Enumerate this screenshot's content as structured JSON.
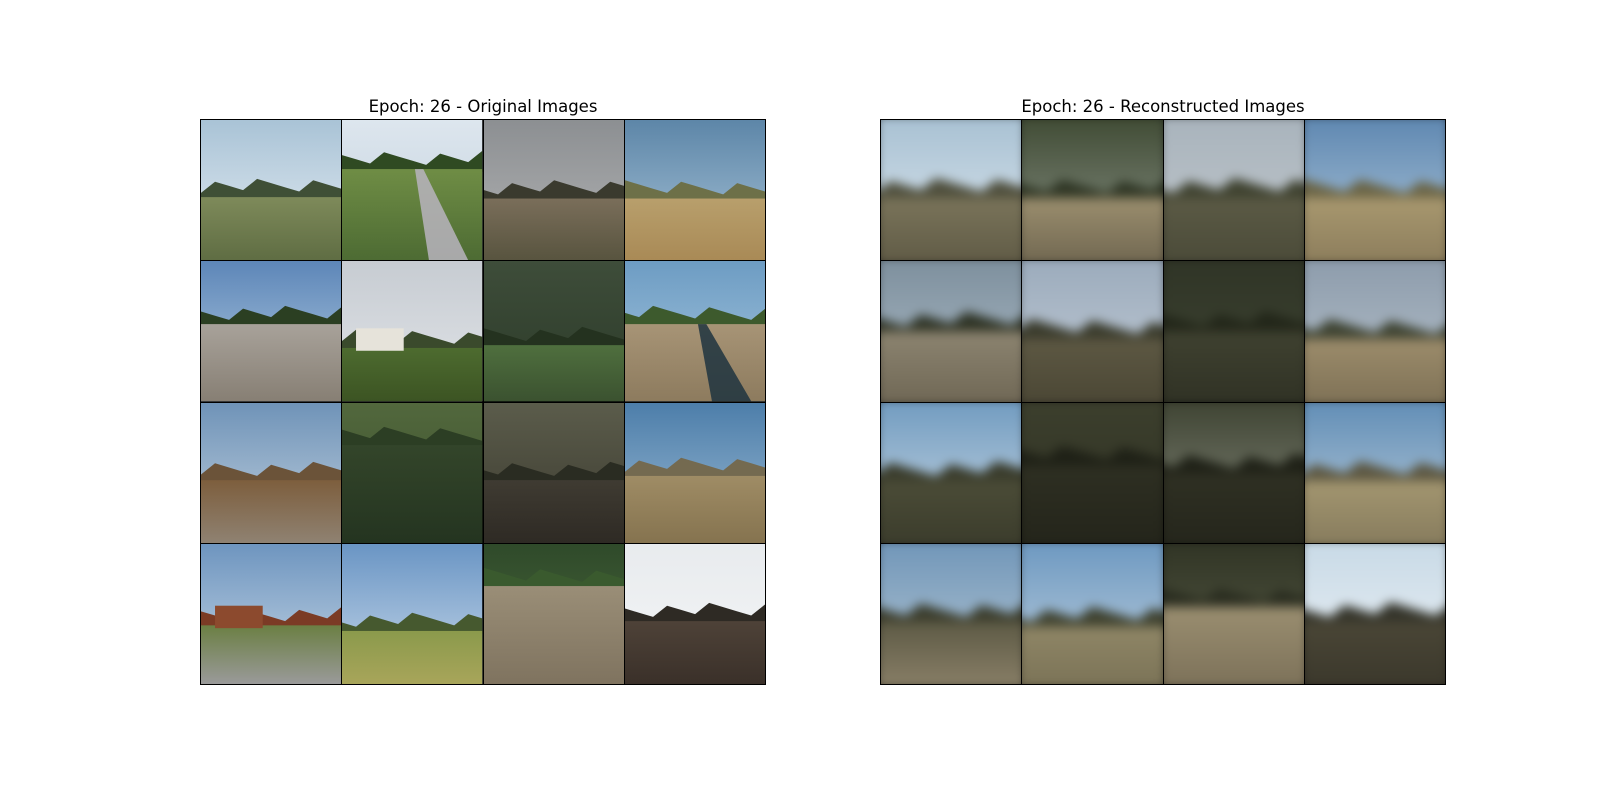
{
  "panels": [
    {
      "title": "Epoch: 26 - Original Images",
      "kind": "original",
      "tiles": [
        {
          "name": "original-tile-1",
          "sky": [
            "#a9c3d6",
            "#e6edf3"
          ],
          "horizon": 0.55,
          "ground": [
            "#7e8a5a",
            "#5f6d43"
          ],
          "trees": "#3f4f36"
        },
        {
          "name": "original-tile-2",
          "sky": [
            "#dde6ee",
            "#c0cfdc"
          ],
          "horizon": 0.35,
          "ground": [
            "#6f8d45",
            "#4d6b33"
          ],
          "trees": "#2f4a22",
          "road": "#b9b4be"
        },
        {
          "name": "original-tile-3",
          "sky": [
            "#8c8f92",
            "#b2b3b4"
          ],
          "horizon": 0.56,
          "ground": [
            "#7a6e5a",
            "#58543f"
          ],
          "trees": "#3a3a2e"
        },
        {
          "name": "original-tile-4",
          "sky": [
            "#5d86a8",
            "#a9c4d8"
          ],
          "horizon": 0.56,
          "ground": [
            "#b89f6c",
            "#a98a56"
          ],
          "trees": "#6d7048"
        },
        {
          "name": "original-tile-5",
          "sky": [
            "#5d86b8",
            "#b6cfe3"
          ],
          "horizon": 0.45,
          "ground": [
            "#a8a29a",
            "#877f74"
          ],
          "trees": "#2b3f22"
        },
        {
          "name": "original-tile-6",
          "sky": [
            "#c7ccd2",
            "#e1e4e8"
          ],
          "horizon": 0.62,
          "ground": [
            "#4d6b2f",
            "#3c5423"
          ],
          "trees": "#3a4a2c",
          "house": "#e6e3da"
        },
        {
          "name": "original-tile-7",
          "sky": [
            "#3e4d3a",
            "#2b3a28"
          ],
          "horizon": 0.6,
          "ground": [
            "#4f6f3e",
            "#3b5230"
          ],
          "trees": "#24321f"
        },
        {
          "name": "original-tile-8",
          "sky": [
            "#6d9cc3",
            "#a8c8df"
          ],
          "horizon": 0.45,
          "ground": [
            "#a79476",
            "#8d7b5e"
          ],
          "trees": "#3d5a2d",
          "road": "#1f3440"
        },
        {
          "name": "original-tile-9",
          "sky": [
            "#6f93b8",
            "#c3d2df"
          ],
          "horizon": 0.55,
          "ground": [
            "#7d5e3d",
            "#8f8272"
          ],
          "trees": "#6b5339"
        },
        {
          "name": "original-tile-10",
          "sky": [
            "#52683d",
            "#3a4e2b"
          ],
          "horizon": 0.3,
          "ground": [
            "#33452a",
            "#243420"
          ],
          "trees": "#2c3e24"
        },
        {
          "name": "original-tile-11",
          "sky": [
            "#5b5c4b",
            "#3b3a2f"
          ],
          "horizon": 0.55,
          "ground": [
            "#3f3b32",
            "#2e2a24"
          ],
          "trees": "#2a2c22"
        },
        {
          "name": "original-tile-12",
          "sky": [
            "#4d7eaa",
            "#9cbbd4"
          ],
          "horizon": 0.52,
          "ground": [
            "#9f8c65",
            "#85734f"
          ],
          "trees": "#746a50"
        },
        {
          "name": "original-tile-13",
          "sky": [
            "#6e95bf",
            "#c7d7e6"
          ],
          "horizon": 0.58,
          "ground": [
            "#6b7f43",
            "#9a9a9a"
          ],
          "trees": "#7b3b25",
          "house": "#8c4a2e"
        },
        {
          "name": "original-tile-14",
          "sky": [
            "#6a95c4",
            "#c8d9ea"
          ],
          "horizon": 0.62,
          "ground": [
            "#8b9a4c",
            "#a8a55a"
          ],
          "trees": "#46592f"
        },
        {
          "name": "original-tile-15",
          "sky": [
            "#2f4a2a",
            "#4d6b3d"
          ],
          "horizon": 0.3,
          "ground": [
            "#9a8e77",
            "#7f735f"
          ],
          "trees": "#3a5a2e"
        },
        {
          "name": "original-tile-16",
          "sky": [
            "#e8ebee",
            "#f4f5f6"
          ],
          "horizon": 0.55,
          "ground": [
            "#4e4238",
            "#3a3029"
          ],
          "trees": "#2e2a24"
        }
      ]
    },
    {
      "title": "Epoch: 26 - Reconstructed Images",
      "kind": "reconstructed",
      "tiles": [
        {
          "name": "reconstructed-tile-1",
          "sky": [
            "#a7c0d2",
            "#dfe8ef"
          ],
          "horizon": 0.55,
          "ground": [
            "#7a745a",
            "#5f5a45"
          ],
          "trees": "#4e4e3c"
        },
        {
          "name": "reconstructed-tile-2",
          "sky": [
            "#3f4a33",
            "#8e978c"
          ],
          "horizon": 0.55,
          "ground": [
            "#9b8e6e",
            "#6f6650"
          ],
          "trees": "#2e3524"
        },
        {
          "name": "reconstructed-tile-3",
          "sky": [
            "#a8b3bc",
            "#c2c8cc"
          ],
          "horizon": 0.55,
          "ground": [
            "#5b5a45",
            "#4a4a38"
          ],
          "trees": "#3f4230"
        },
        {
          "name": "reconstructed-tile-4",
          "sky": [
            "#5d86b0",
            "#b4cbdc"
          ],
          "horizon": 0.55,
          "ground": [
            "#a8986f",
            "#8b7c5b"
          ],
          "trees": "#6a6446"
        },
        {
          "name": "reconstructed-tile-5",
          "sky": [
            "#7c8e9c",
            "#b0bfca"
          ],
          "horizon": 0.5,
          "ground": [
            "#8c8470",
            "#6e6654"
          ],
          "trees": "#2e3325"
        },
        {
          "name": "reconstructed-tile-6",
          "sky": [
            "#9aaabb",
            "#c5ced8"
          ],
          "horizon": 0.55,
          "ground": [
            "#5d5843",
            "#4a4634"
          ],
          "trees": "#3a3b2c"
        },
        {
          "name": "reconstructed-tile-7",
          "sky": [
            "#2f3426",
            "#3f4533"
          ],
          "horizon": 0.5,
          "ground": [
            "#3f4130",
            "#2f3124"
          ],
          "trees": "#222619"
        },
        {
          "name": "reconstructed-tile-8",
          "sky": [
            "#8c9bab",
            "#b8c3cc"
          ],
          "horizon": 0.55,
          "ground": [
            "#9c8c6b",
            "#7d7055"
          ],
          "trees": "#3e4332"
        },
        {
          "name": "reconstructed-tile-9",
          "sky": [
            "#6f9abf",
            "#d0dce6"
          ],
          "horizon": 0.55,
          "ground": [
            "#4b4c37",
            "#3a3b2b"
          ],
          "trees": "#3a3c2c"
        },
        {
          "name": "reconstructed-tile-10",
          "sky": [
            "#3c3f2d",
            "#2e3022"
          ],
          "horizon": 0.45,
          "ground": [
            "#2e2f22",
            "#23241a"
          ],
          "trees": "#1e2016"
        },
        {
          "name": "reconstructed-tile-11",
          "sky": [
            "#3d4231",
            "#8b8f82"
          ],
          "horizon": 0.5,
          "ground": [
            "#2f3023",
            "#24251b"
          ],
          "trees": "#1f2117"
        },
        {
          "name": "reconstructed-tile-12",
          "sky": [
            "#5f8cb5",
            "#c1d1dd"
          ],
          "horizon": 0.55,
          "ground": [
            "#a39670",
            "#857a5c"
          ],
          "trees": "#5c5742"
        },
        {
          "name": "reconstructed-tile-13",
          "sky": [
            "#6f95b8",
            "#b9c9d4"
          ],
          "horizon": 0.55,
          "ground": [
            "#5d5a45",
            "#8a8068"
          ],
          "trees": "#3b3d2d"
        },
        {
          "name": "reconstructed-tile-14",
          "sky": [
            "#6b97c0",
            "#c4d3df"
          ],
          "horizon": 0.58,
          "ground": [
            "#8f8666",
            "#7a7256"
          ],
          "trees": "#3e412f"
        },
        {
          "name": "reconstructed-tile-15",
          "sky": [
            "#2f3324",
            "#5c6049"
          ],
          "horizon": 0.45,
          "ground": [
            "#9a8e70",
            "#7b7058"
          ],
          "trees": "#2a2d20"
        },
        {
          "name": "reconstructed-tile-16",
          "sky": [
            "#c7d9e6",
            "#eef2f5"
          ],
          "horizon": 0.55,
          "ground": [
            "#4a4636",
            "#3a372b"
          ],
          "trees": "#34342a"
        }
      ]
    }
  ]
}
